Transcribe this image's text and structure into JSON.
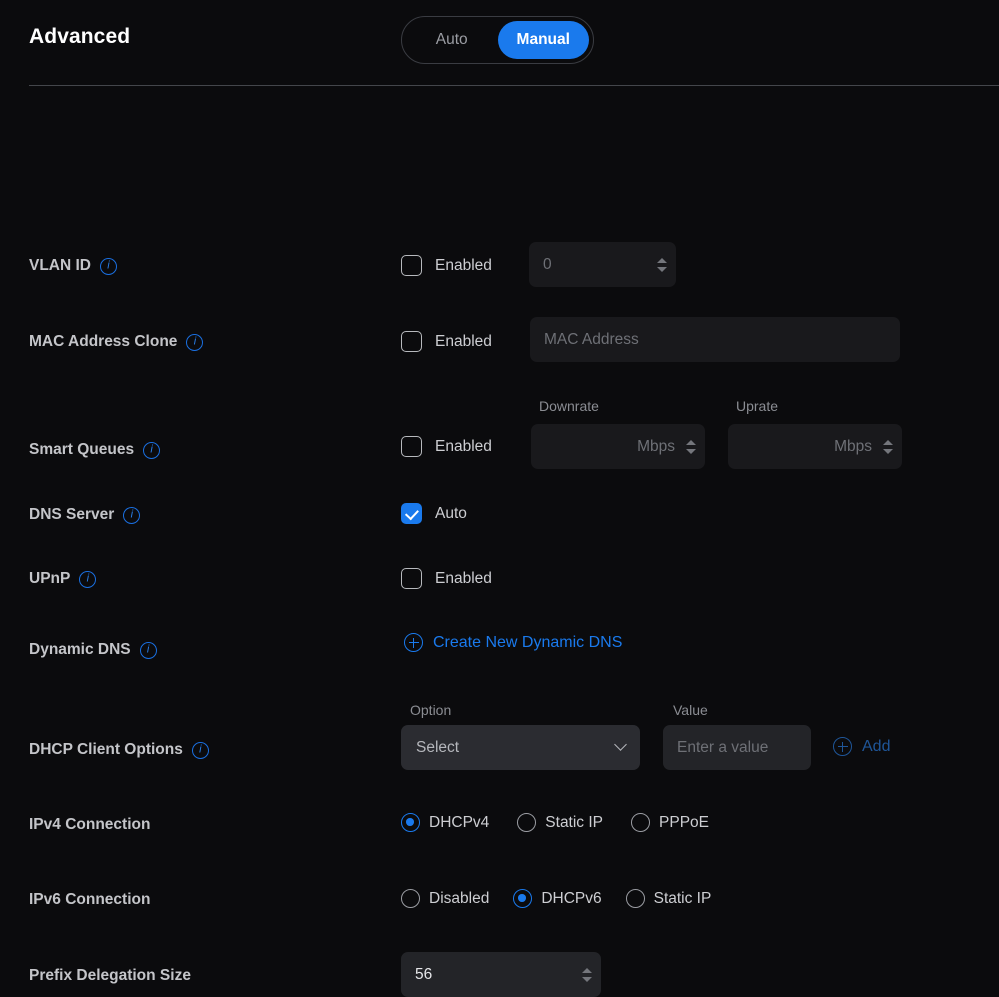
{
  "header": {
    "title": "Advanced",
    "mode_toggle": {
      "name": "advanced-mode-toggle",
      "options": [
        "Auto",
        "Manual"
      ],
      "selected": "Manual",
      "accent": "#1a7aed"
    }
  },
  "rows": {
    "vlan_id": {
      "label": "VLAN ID",
      "checkbox_label": "Enabled",
      "checked": false,
      "input_placeholder": "0"
    },
    "mac_clone": {
      "label": "MAC Address Clone",
      "checkbox_label": "Enabled",
      "checked": false,
      "input_placeholder": "MAC Address"
    },
    "smart_queues": {
      "label": "Smart Queues",
      "checkbox_label": "Enabled",
      "checked": false,
      "downrate_label": "Downrate",
      "downrate_placeholder": "Mbps",
      "uprate_label": "Uprate",
      "uprate_placeholder": "Mbps"
    },
    "dns_server": {
      "label": "DNS Server",
      "checkbox_label": "Auto",
      "checked": true
    },
    "upnp": {
      "label": "UPnP",
      "checkbox_label": "Enabled",
      "checked": false
    },
    "dynamic_dns": {
      "label": "Dynamic DNS",
      "create_link": "Create New Dynamic DNS"
    },
    "dhcp_client_options": {
      "label": "DHCP Client Options",
      "option_label": "Option",
      "option_selected": "Select",
      "value_label": "Value",
      "value_placeholder": "Enter a value",
      "add_label": "Add"
    },
    "ipv4_connection": {
      "label": "IPv4 Connection",
      "options": [
        "DHCPv4",
        "Static IP",
        "PPPoE"
      ],
      "selected": "DHCPv4"
    },
    "ipv6_connection": {
      "label": "IPv6 Connection",
      "options": [
        "Disabled",
        "DHCPv6",
        "Static IP"
      ],
      "selected": "DHCPv6"
    },
    "prefix_delegation_size": {
      "label": "Prefix Delegation Size",
      "value": "56"
    }
  },
  "icons": {
    "info": "i",
    "info_tooltip_icon": "info-icon",
    "plus": "plus-icon",
    "chevron": "chevron-down-icon"
  }
}
